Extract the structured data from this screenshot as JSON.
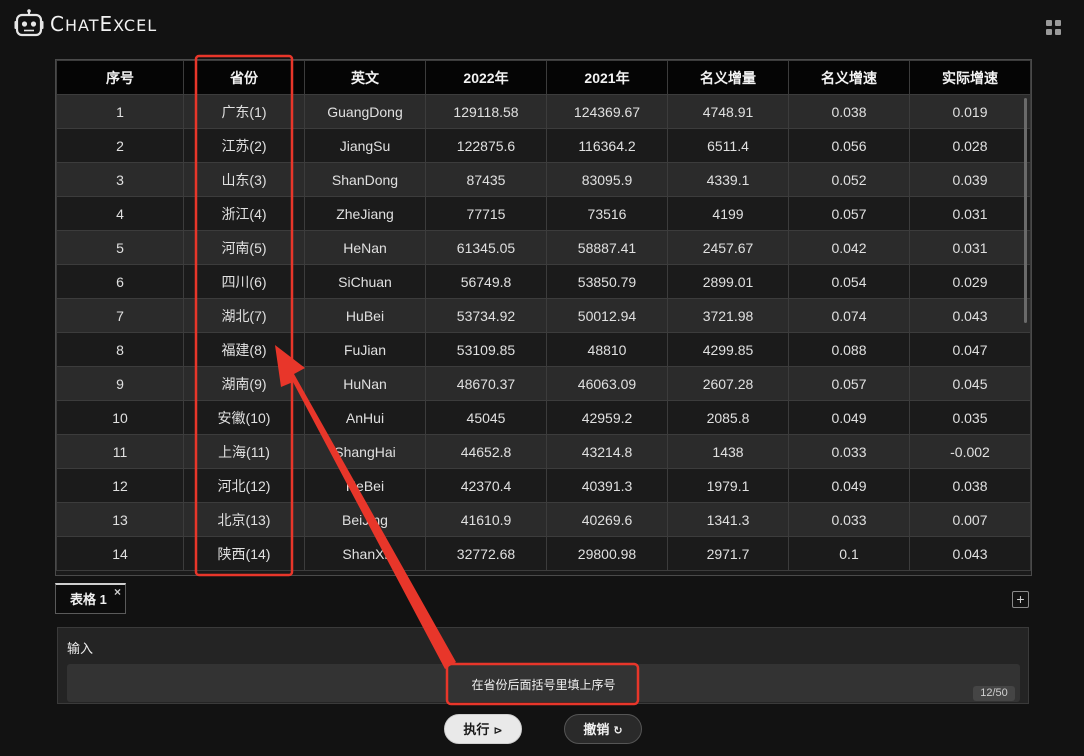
{
  "app": {
    "logo_text_first": "C",
    "logo_text_rest": "HAT",
    "logo_text_second_first": "E",
    "logo_text_second_rest": "XCEL"
  },
  "table": {
    "headers": [
      "序号",
      "省份",
      "英文",
      "2022年",
      "2021年",
      "名义增量",
      "名义增速",
      "实际增速"
    ],
    "rows": [
      [
        "1",
        "广东(1)",
        "GuangDong",
        "129118.58",
        "124369.67",
        "4748.91",
        "0.038",
        "0.019"
      ],
      [
        "2",
        "江苏(2)",
        "JiangSu",
        "122875.6",
        "116364.2",
        "6511.4",
        "0.056",
        "0.028"
      ],
      [
        "3",
        "山东(3)",
        "ShanDong",
        "87435",
        "83095.9",
        "4339.1",
        "0.052",
        "0.039"
      ],
      [
        "4",
        "浙江(4)",
        "ZheJiang",
        "77715",
        "73516",
        "4199",
        "0.057",
        "0.031"
      ],
      [
        "5",
        "河南(5)",
        "HeNan",
        "61345.05",
        "58887.41",
        "2457.67",
        "0.042",
        "0.031"
      ],
      [
        "6",
        "四川(6)",
        "SiChuan",
        "56749.8",
        "53850.79",
        "2899.01",
        "0.054",
        "0.029"
      ],
      [
        "7",
        "湖北(7)",
        "HuBei",
        "53734.92",
        "50012.94",
        "3721.98",
        "0.074",
        "0.043"
      ],
      [
        "8",
        "福建(8)",
        "FuJian",
        "53109.85",
        "48810",
        "4299.85",
        "0.088",
        "0.047"
      ],
      [
        "9",
        "湖南(9)",
        "HuNan",
        "48670.37",
        "46063.09",
        "2607.28",
        "0.057",
        "0.045"
      ],
      [
        "10",
        "安徽(10)",
        "AnHui",
        "45045",
        "42959.2",
        "2085.8",
        "0.049",
        "0.035"
      ],
      [
        "11",
        "上海(11)",
        "ShangHai",
        "44652.8",
        "43214.8",
        "1438",
        "0.033",
        "-0.002"
      ],
      [
        "12",
        "河北(12)",
        "HeBei",
        "42370.4",
        "40391.3",
        "1979.1",
        "0.049",
        "0.038"
      ],
      [
        "13",
        "北京(13)",
        "BeiJing",
        "41610.9",
        "40269.6",
        "1341.3",
        "0.033",
        "0.007"
      ],
      [
        "14",
        "陕西(14)",
        "ShanXi",
        "32772.68",
        "29800.98",
        "2971.7",
        "0.1",
        "0.043"
      ]
    ]
  },
  "tabs": [
    {
      "label": "表格 1",
      "close": "×"
    }
  ],
  "add_tab_label": "+",
  "input": {
    "label": "输入",
    "value": "在省份后面括号里填上序号",
    "char_count": "12/50"
  },
  "buttons": {
    "run_label": "执行",
    "run_icon": "⊳",
    "undo_label": "撤销",
    "undo_icon": "↻"
  },
  "colors": {
    "annotation_red": "#e8362a",
    "background": "#121212"
  }
}
